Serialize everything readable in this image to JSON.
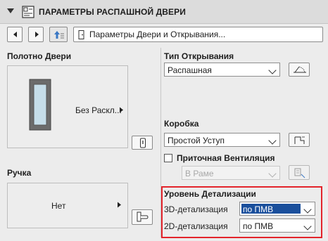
{
  "header": {
    "title": "ПАРАМЕТРЫ РАСПАШНОЙ ДВЕРИ",
    "icon": "door-settings-icon"
  },
  "toolbar": {
    "prev_icon": "triangle-left-icon",
    "next_icon": "triangle-right-icon",
    "page_selector": "Параметры Двери и Открывания..."
  },
  "left": {
    "door_leaf_label": "Полотно Двери",
    "door_leaf_option": "Без Раскл...",
    "handle_label": "Ручка",
    "handle_option": "Нет"
  },
  "right": {
    "opening_type_label": "Тип Открывания",
    "opening_type_value": "Распашная",
    "frame_label": "Коробка",
    "frame_value": "Простой Уступ",
    "ventilation_label": "Приточная Вентиляция",
    "ventilation_checked": false,
    "ventilation_value": "В Раме",
    "detail_level_label": "Уровень Детализации",
    "detail_3d_label": "3D-детализация",
    "detail_3d_value": "по ПМВ",
    "detail_2d_label": "2D-детализация",
    "detail_2d_value": "по ПМВ"
  },
  "colors": {
    "selection_blue": "#1a4f9c",
    "highlight_red": "#e3242b",
    "door_frame": "#6b6b6b",
    "door_glass": "#c5dde9"
  }
}
